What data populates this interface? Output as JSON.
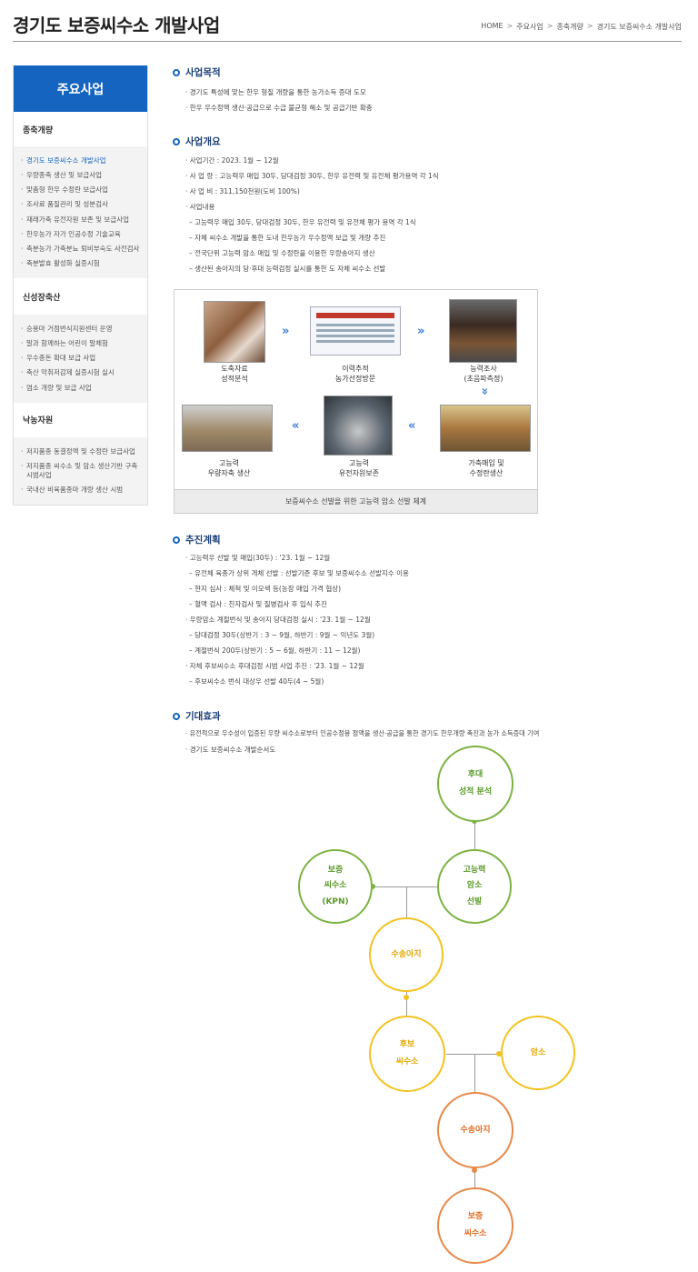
{
  "header": {
    "title": "경기도 보증씨수소 개발사업",
    "breadcrumb": [
      "HOME",
      "주요사업",
      "종축개량",
      "경기도 보증씨수소 개발사업"
    ]
  },
  "sidebar": {
    "title": "주요사업",
    "groups": [
      {
        "label": "종축개량",
        "items": [
          "경기도 보증씨수소 개발사업",
          "우량종축 생산 및 보급사업",
          "맞춤형 한우 수정란 보급사업",
          "조사료 품질관리 및 성분검사",
          "재래가축 유전자원 보존 및 보급사업",
          "한우농가 자가 인공수정 기술교육",
          "축분농가 가축분뇨 퇴비부숙도 사전검사",
          "축분발효 활성화 실증시험"
        ]
      },
      {
        "label": "신성장축산",
        "items": [
          "승용마 거점번식지원센터 운영",
          "말과 함께하는 어린이 말체험",
          "우수종돈 확대 보급 사업",
          "축산 악취저감제 실증시험 실시",
          "염소 개량 및 보급 사업"
        ]
      },
      {
        "label": "낙농자원",
        "items": [
          "저지품종 동결정액 및 수정란 보급사업",
          "저지품종 씨수소 및 암소 생산기반 구축 시범사업",
          "국내산 비육품종마 개량 생산 시범"
        ]
      }
    ]
  },
  "sections": {
    "purpose": {
      "title": "사업목적",
      "lines": [
        "· 경기도 특성에 맞는 한우 형질 개량을 통한 농가소득 증대 도모",
        "· 한우 우수정액 생산·공급으로 수급 불균형 해소 및 공급기반 확충"
      ]
    },
    "overview": {
      "title": "사업개요",
      "lines": [
        "· 사업기간 : 2023. 1월 ~ 12월",
        "· 사 업 량 : 고능력우 매입 30두, 당대검정 30두, 한우 유전력 및 유전체 평가용역 각 1식",
        "· 사 업 비 : 311,150천원(도비 100%)",
        "· 사업내용"
      ],
      "sublines": [
        "– 고능력우 매입 30두, 당대검정 30두, 한우 유전력 및 유전체 평가 용역 각 1식",
        "– 자체 씨수소 개발을 통한 도내 한우농가 우수정액 보급 및 개량 추진",
        "– 전국단위 고능력 암소 매입 및 수정란을 이용한 우량송아지 생산",
        "– 생산된 송아지의 당·후대 능력검정 실시를 통한 도 자체 씨수소 선발"
      ]
    },
    "flow": {
      "steps": [
        {
          "label1": "도축자료",
          "label2": "성적분석"
        },
        {
          "label1": "이력추적",
          "label2": "농가선정방문"
        },
        {
          "label1": "능력조사",
          "label2": "(초음파측정)"
        },
        {
          "label1": "가축매입 및",
          "label2": "수정란생산"
        },
        {
          "label1": "고능력",
          "label2": "유전자원보존"
        },
        {
          "label1": "고능력",
          "label2": "우량자축 생산"
        }
      ],
      "caption": "보증씨수소 선발을 위한 고능력 암소 선발 체계"
    },
    "plan": {
      "title": "추진계획",
      "rows": [
        {
          "kind": "b",
          "text": "· 고능력우 선발 및 매입(30두) : '23. 1월 ~ 12월"
        },
        {
          "kind": "d",
          "text": "– 유전체 육종가 상위 개체 선발 : 선발기준 후보 및 보증씨수소 선발지수 이용"
        },
        {
          "kind": "d",
          "text": "– 현지 심사 : 체척 및 이모색 등(농장 매입 가격 협상)"
        },
        {
          "kind": "d",
          "text": "– 혈액 검사 : 친자검사 및 질병검사 후 입식 추진"
        },
        {
          "kind": "b",
          "text": "· 우량암소 계절번식 및 송아지 당대검정 실시 : '23. 1월 ~ 12월"
        },
        {
          "kind": "d",
          "text": "– 당대검정 30두(상반기 : 3 ~ 9월, 하반기 : 9월 ~ 익년도 3월)"
        },
        {
          "kind": "d",
          "text": "– 계절번식 200두(상반기 : 5 ~ 6월, 하반기 : 11 ~ 12월)"
        },
        {
          "kind": "b",
          "text": "· 자체 후보씨수소 후대검정 시범 사업 추진 : '23. 1월 ~ 12월"
        },
        {
          "kind": "d",
          "text": "– 후보씨수소 번식 대상우 선발 40두(4 ~ 5월)"
        }
      ]
    },
    "effect": {
      "title": "기대효과",
      "lines": [
        "· 유전적으로 우수성이 입증된 우량 씨수소로부터 인공수정용 정액을 생산·공급을 통한 경기도 한우개량 촉진과 농가 소득증대 기여",
        "· 경기도 보증씨수소 개발순서도"
      ]
    }
  },
  "diagram": {
    "nodes": {
      "huedae": [
        "후대",
        "성적 분석"
      ],
      "bojeung_kpn": [
        "보증",
        "씨수소",
        "(KPN)"
      ],
      "goneungnyeok": [
        "고능력",
        "암소",
        "선발"
      ],
      "songaji1": [
        "수송아지"
      ],
      "hubo": [
        "후보",
        "씨수소"
      ],
      "amso": [
        "암소"
      ],
      "songaji2": [
        "수송아지"
      ],
      "bojeung": [
        "보증",
        "씨수소"
      ]
    },
    "colors": {
      "green": "#7cb342",
      "yellow": "#f3c220",
      "orange": "#e8894a"
    }
  }
}
